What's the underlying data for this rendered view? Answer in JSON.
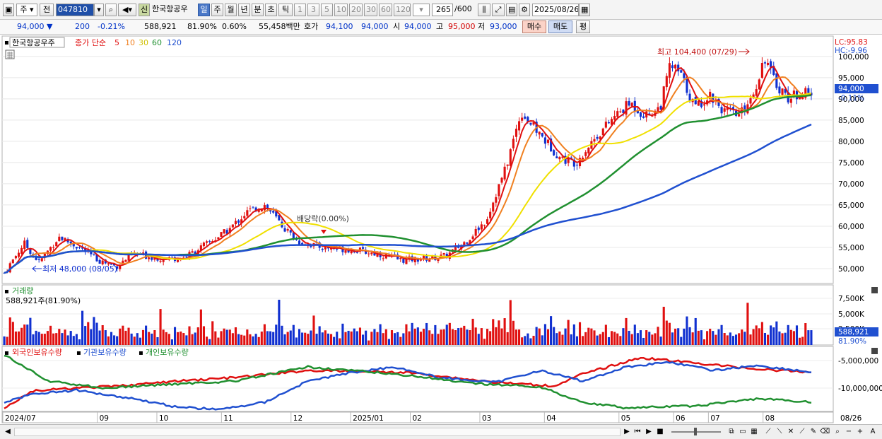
{
  "toolbar": {
    "code": "047810",
    "type_label": "주",
    "prev_label": "전",
    "badge": "신",
    "stock_name": "한국항공우",
    "periods": [
      "일",
      "주",
      "월",
      "년",
      "분",
      "초",
      "틱"
    ],
    "period_selected": "일",
    "intervals": [
      "1",
      "3",
      "5",
      "10",
      "20",
      "30",
      "60",
      "120"
    ],
    "count": "265",
    "count_total": "/600",
    "date": "2025/08/26"
  },
  "quote": {
    "price": "94,000",
    "change": "200",
    "change_pct": "-0.21%",
    "volume": "588,921",
    "volume_ratio": "81.90%",
    "turnover_pct": "0.60%",
    "amount": "55,458백만",
    "ask_label": "호가",
    "ask_price": "94,100",
    "bid_price": "94,000",
    "open_label": "시",
    "open": "94,000",
    "high_label": "고",
    "high": "95,000",
    "low_label": "저",
    "low": "93,000",
    "buy_label": "매수",
    "sell_label": "매도",
    "avg_label": "평"
  },
  "price_panel": {
    "stock_title": "한국항공우주",
    "ma_label": "종가 단순",
    "ma_periods": [
      "5",
      "10",
      "30",
      "60",
      "120"
    ],
    "lc_label": "LC:95.83",
    "hc_label": "HC:-9.96",
    "high_annotation": "최고 104,400 (07/29)",
    "low_annotation": "최저 48,000 (08/05)",
    "dividend_annotation": "배당락(0.00%)",
    "current_price_tag": "94,000",
    "current_change_tag": "-0.11%",
    "y_ticks": [
      "100,000",
      "95,000",
      "90,000",
      "85,000",
      "80,000",
      "75,000",
      "70,000",
      "65,000",
      "60,000",
      "55,000",
      "50,000"
    ]
  },
  "volume_panel": {
    "title": "거래량",
    "summary": "588,921주(81.90%)",
    "y_ticks": [
      "7,500K",
      "5,000K",
      "2,500K"
    ],
    "current_tag": "588,921",
    "current_pct": "81.90%"
  },
  "holding_panel": {
    "legend": [
      "외국인보유수량",
      "기관보유수량",
      "개인보유수량"
    ],
    "y_ticks": [
      "-5,000,000",
      "-10,000,000"
    ]
  },
  "x_axis": [
    "2024/07",
    "09",
    "10",
    "11",
    "12",
    "2025/01",
    "02",
    "03",
    "04",
    "05",
    "06",
    "07",
    "08",
    "08/26"
  ],
  "colors": {
    "up": "#e01010",
    "down": "#1030d0",
    "ma5": "#e01010",
    "ma10": "#f08020",
    "ma30": "#f0e000",
    "ma60": "#209030",
    "ma120": "#2050d0",
    "foreign": "#e01010",
    "institution": "#2050d0",
    "individual": "#209030"
  },
  "chart_data": {
    "type": "line",
    "price_series_approx": {
      "name": "종가",
      "x": [
        "2024/07",
        "09",
        "10",
        "11",
        "12",
        "2025/01",
        "02",
        "03",
        "04",
        "05",
        "06",
        "07",
        "08",
        "08/26"
      ],
      "values": [
        51000,
        50000,
        52000,
        58000,
        55000,
        54000,
        52000,
        62000,
        76000,
        83000,
        86000,
        98000,
        92000,
        94000
      ]
    },
    "ma120_approx": [
      52000,
      52000,
      52500,
      53500,
      54500,
      55000,
      55500,
      57000,
      62000,
      68000,
      73000,
      79000,
      84000,
      86000
    ],
    "ylim": [
      47000,
      104000
    ]
  }
}
